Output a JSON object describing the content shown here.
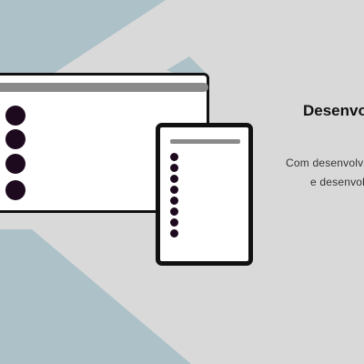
{
  "colors": {
    "background": "#d9d9d9",
    "accent_shape": "#adc1c8",
    "device_frame": "#111111",
    "placeholder_bar": "#8a8a8a",
    "list_dot": "#1e0a1e",
    "screen": "#ffffff"
  },
  "illustration": {
    "desktop_window": {
      "icon": "desktop-window-icon",
      "list_item_count": 4
    },
    "mobile_device": {
      "icon": "mobile-phone-icon",
      "list_item_count": 8
    }
  },
  "content": {
    "headline": "Desenvo",
    "description_line_1": "Com desenvolv",
    "description_line_2": "e desenvol"
  }
}
